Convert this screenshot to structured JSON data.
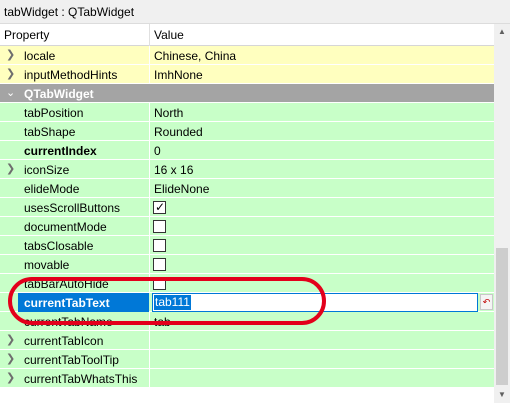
{
  "window": {
    "title": "tabWidget : QTabWidget"
  },
  "header": {
    "property": "Property",
    "value": "Value"
  },
  "colors": {
    "green_row": "#c8ffc8",
    "yellow_row": "#ffffbf",
    "group_row": "#a4a4a4",
    "selection": "#0078d7",
    "annotation": "#e3001b"
  },
  "rows": [
    {
      "property": "locale",
      "value": "Chinese, China",
      "expandable": true
    },
    {
      "property": "inputMethodHints",
      "value": "ImhNone",
      "expandable": true
    },
    {
      "property": "QTabWidget",
      "value": "",
      "group": true
    },
    {
      "property": "tabPosition",
      "value": "North"
    },
    {
      "property": "tabShape",
      "value": "Rounded"
    },
    {
      "property": "currentIndex",
      "value": "0",
      "bold": true
    },
    {
      "property": "iconSize",
      "value": "16 x 16",
      "expandable": true
    },
    {
      "property": "elideMode",
      "value": "ElideNone"
    },
    {
      "property": "usesScrollButtons",
      "value": "",
      "checked": true
    },
    {
      "property": "documentMode",
      "value": "",
      "checked": false
    },
    {
      "property": "tabsClosable",
      "value": "",
      "checked": false
    },
    {
      "property": "movable",
      "value": "",
      "checked": false
    },
    {
      "property": "tabBarAutoHide",
      "value": "",
      "checked": false
    },
    {
      "property": "currentTabText",
      "value": "tab111",
      "bold": true,
      "editing": true
    },
    {
      "property": "currentTabName",
      "value": "tab"
    },
    {
      "property": "currentTabIcon",
      "value": "",
      "expandable": true
    },
    {
      "property": "currentTabToolTip",
      "value": "",
      "expandable": true
    },
    {
      "property": "currentTabWhatsThis",
      "value": "",
      "expandable": true
    }
  ],
  "icons": {
    "expand": "chevron-right-icon",
    "collapse": "chevron-down-icon",
    "reset": "reset-arrow-icon",
    "checkmark": "check-icon"
  }
}
